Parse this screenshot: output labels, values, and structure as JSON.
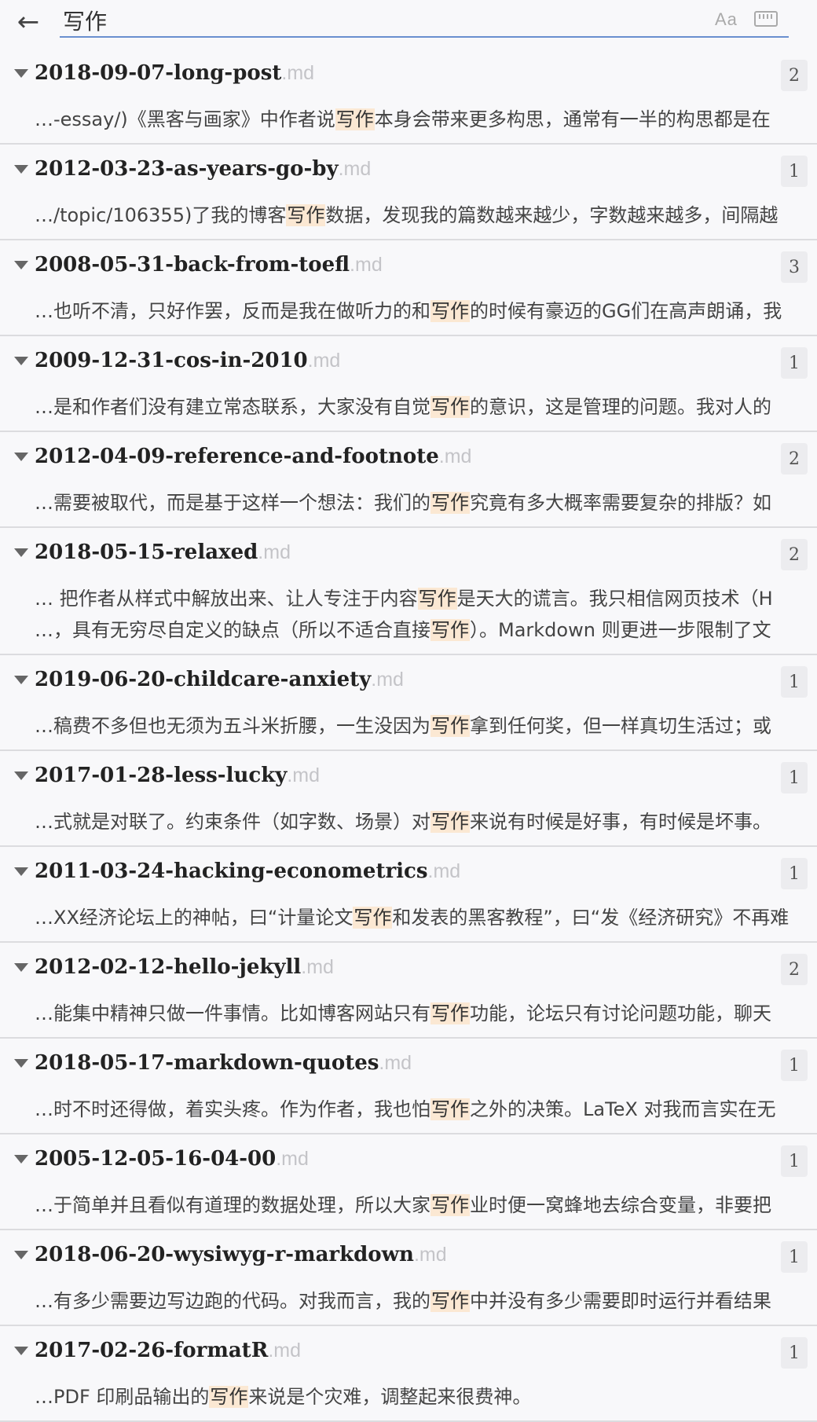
{
  "search": {
    "query": "写作",
    "case_label": "Aa",
    "back_icon": "arrow-left-icon",
    "keyboard_icon": "keyboard-icon"
  },
  "results": [
    {
      "name": "2018-09-07-long-post",
      "ext": ".md",
      "count": "2",
      "snippets": [
        [
          "…-essay/)《黑客与画家》中作者说",
          "写作",
          "本身会带来更多构思，通常有一半的构思都是在"
        ]
      ]
    },
    {
      "name": "2012-03-23-as-years-go-by",
      "ext": ".md",
      "count": "1",
      "snippets": [
        [
          "…/topic/106355)了我的博客",
          "写作",
          "数据，发现我的篇数越来越少，字数越来越多，间隔越"
        ]
      ]
    },
    {
      "name": "2008-05-31-back-from-toefl",
      "ext": ".md",
      "count": "3",
      "snippets": [
        [
          "…也听不清，只好作罢，反而是我在做听力的和",
          "写作",
          "的时候有豪迈的GG们在高声朗诵，我"
        ]
      ]
    },
    {
      "name": "2009-12-31-cos-in-2010",
      "ext": ".md",
      "count": "1",
      "snippets": [
        [
          "…是和作者们没有建立常态联系，大家没有自觉",
          "写作",
          "的意识，这是管理的问题。我对人的"
        ]
      ]
    },
    {
      "name": "2012-04-09-reference-and-footnote",
      "ext": ".md",
      "count": "2",
      "snippets": [
        [
          "…需要被取代，而是基于这样一个想法：我们的",
          "写作",
          "究竟有多大概率需要复杂的排版？如"
        ]
      ]
    },
    {
      "name": "2018-05-15-relaxed",
      "ext": ".md",
      "count": "2",
      "snippets": [
        [
          "… 把作者从样式中解放出来、让人专注于内容",
          "写作",
          "是天大的谎言。我只相信网页技术（H"
        ],
        [
          "…，具有无穷尽自定义的缺点（所以不适合直接",
          "写作",
          "）。Markdown 则更进一步限制了文"
        ]
      ]
    },
    {
      "name": "2019-06-20-childcare-anxiety",
      "ext": ".md",
      "count": "1",
      "snippets": [
        [
          "…稿费不多但也无须为五斗米折腰，一生没因为",
          "写作",
          "拿到任何奖，但一样真切生活过；或"
        ]
      ]
    },
    {
      "name": "2017-01-28-less-lucky",
      "ext": ".md",
      "count": "1",
      "snippets": [
        [
          "…式就是对联了。约束条件（如字数、场景）对",
          "写作",
          "来说有时候是好事，有时候是坏事。"
        ]
      ]
    },
    {
      "name": "2011-03-24-hacking-econometrics",
      "ext": ".md",
      "count": "1",
      "snippets": [
        [
          "…XX经济论坛上的神帖，曰“计量论文",
          "写作",
          "和发表的黑客教程”，曰“发《经济研究》不再难"
        ]
      ]
    },
    {
      "name": "2012-02-12-hello-jekyll",
      "ext": ".md",
      "count": "2",
      "snippets": [
        [
          "…能集中精神只做一件事情。比如博客网站只有",
          "写作",
          "功能，论坛只有讨论问题功能，聊天"
        ]
      ]
    },
    {
      "name": "2018-05-17-markdown-quotes",
      "ext": ".md",
      "count": "1",
      "snippets": [
        [
          "…时不时还得做，着实头疼。作为作者，我也怕",
          "写作",
          "之外的决策。LaTeX 对我而言实在无"
        ]
      ]
    },
    {
      "name": "2005-12-05-16-04-00",
      "ext": ".md",
      "count": "1",
      "snippets": [
        [
          "…于简单并且看似有道理的数据处理，所以大家",
          "写作",
          "业时便一窝蜂地去综合变量，非要把"
        ]
      ]
    },
    {
      "name": "2018-06-20-wysiwyg-r-markdown",
      "ext": ".md",
      "count": "1",
      "snippets": [
        [
          "…有多少需要边写边跑的代码。对我而言，我的",
          "写作",
          "中并没有多少需要即时运行并看结果"
        ]
      ]
    },
    {
      "name": "2017-02-26-formatR",
      "ext": ".md",
      "count": "1",
      "snippets": [
        [
          "…PDF 印刷品输出的",
          "写作",
          "来说是个灾难，调整起来很费神。"
        ]
      ]
    }
  ]
}
